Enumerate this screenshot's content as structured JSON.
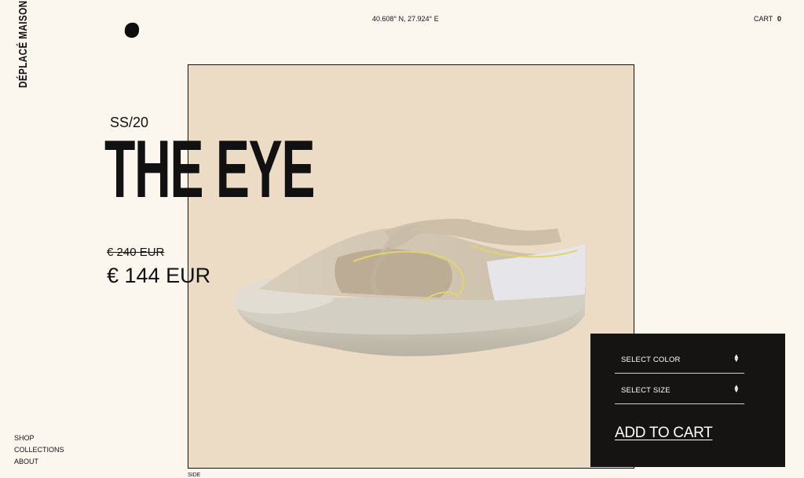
{
  "brand": "DÉPLACÉ MAISON",
  "header": {
    "coords": "40.608° N, 27.924° E",
    "cart_label": "CART",
    "cart_count": "0"
  },
  "product": {
    "season": "SS/20",
    "title": "THE EYE",
    "old_price": "€ 240 EUR",
    "price": "€ 144 EUR",
    "view_label": "SIDE"
  },
  "nav": {
    "items": [
      "SHOP",
      "COLLECTIONS",
      "ABOUT"
    ]
  },
  "purchase": {
    "color_select": "SELECT COLOR",
    "size_select": "SELECT SIZE",
    "add_to_cart": "ADD TO CART"
  },
  "colors": {
    "background": "#fbf7ee",
    "photo_bg": "#ecdcc6",
    "panel": "#151413"
  }
}
